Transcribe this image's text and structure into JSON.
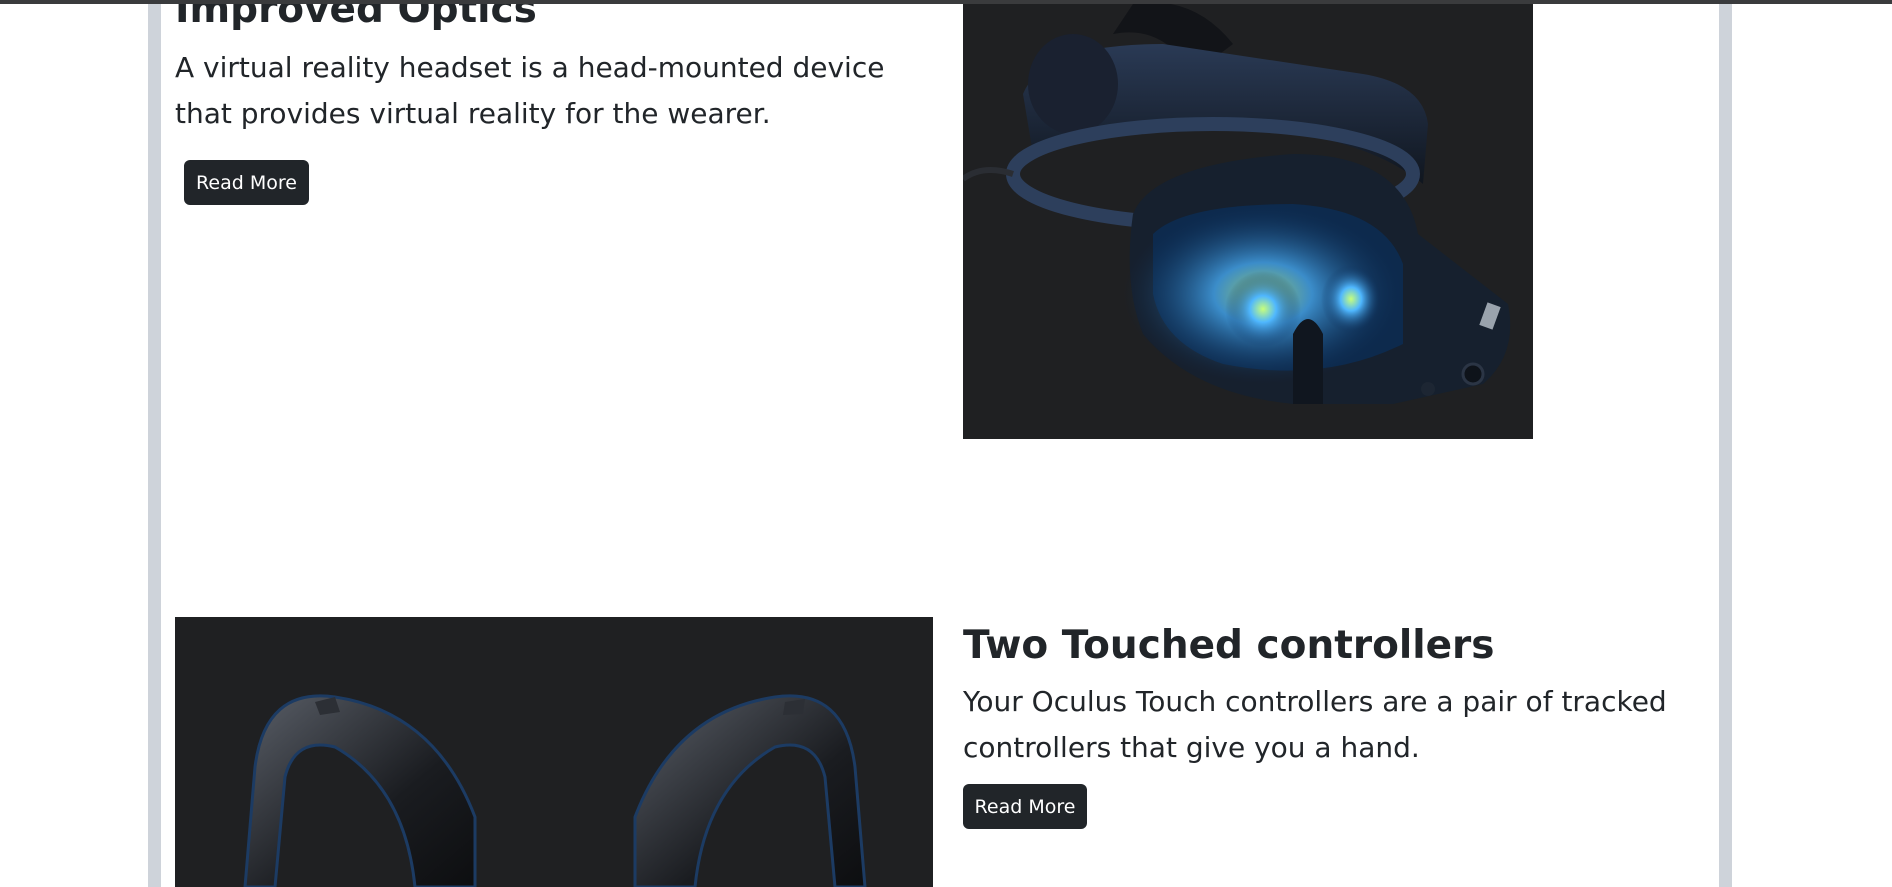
{
  "sections": [
    {
      "title": "Improved Optics",
      "description": "A virtual reality headset is a head-mounted device that provides virtual reality for the wearer.",
      "button_label": "Read More",
      "image_icon": "vr-headset-image"
    },
    {
      "title": "Two Touched controllers",
      "description": "Your Oculus Touch controllers are a pair of tracked controllers that give you a hand.",
      "button_label": "Read More",
      "image_icon": "touch-controllers-image"
    }
  ],
  "colors": {
    "button_bg": "#212529",
    "button_text": "#ffffff",
    "frame_border": "#ced3da",
    "image_bg": "#1f2022",
    "lens_glow": "#3aa0ff"
  }
}
